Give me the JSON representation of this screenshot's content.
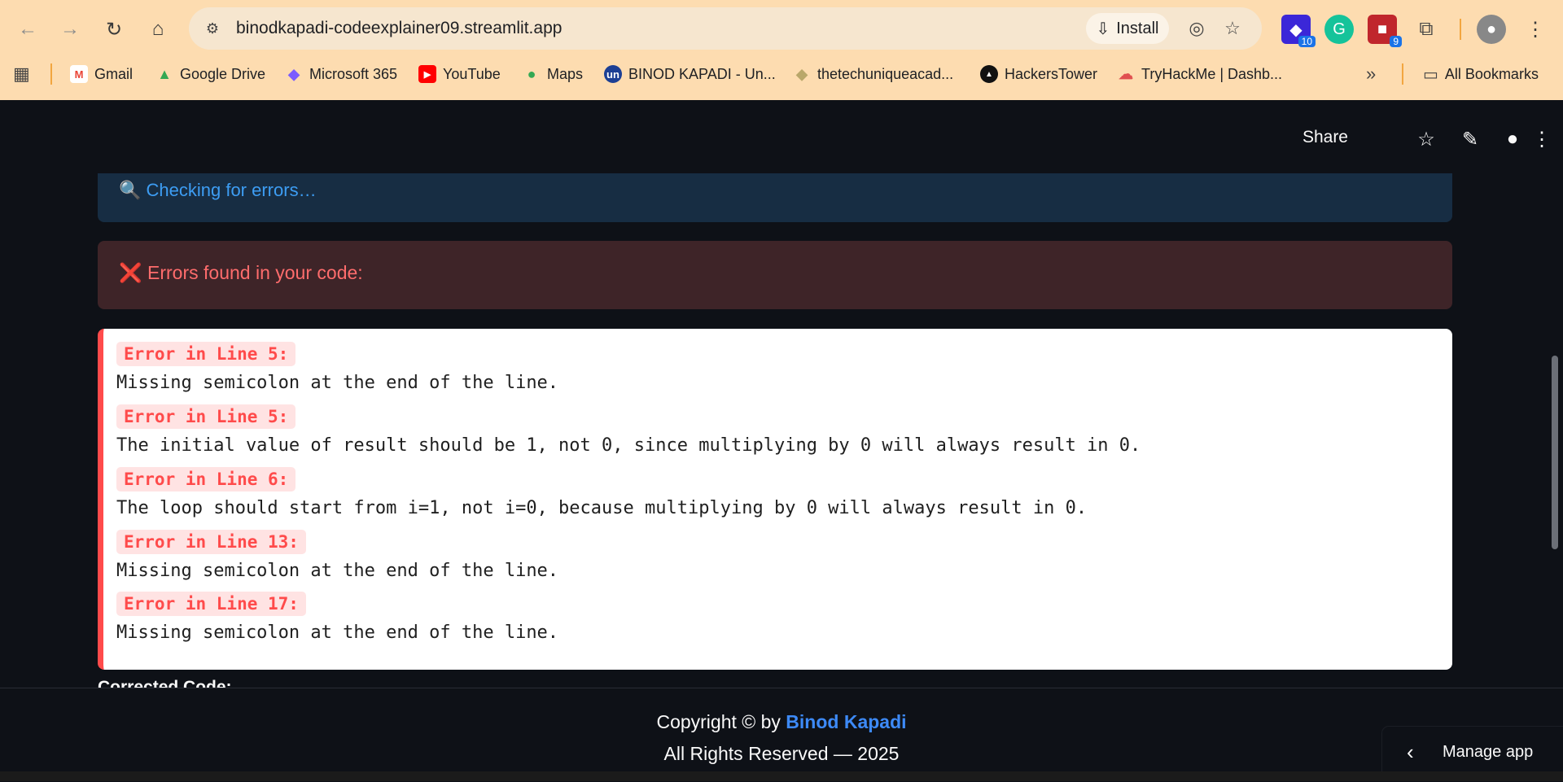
{
  "browser": {
    "url": "binodkapadi-codeexplainer09.streamlit.app",
    "install_label": "Install",
    "extensions": [
      {
        "name": "extension-1",
        "badge": "10",
        "color": "#3b27d8"
      },
      {
        "name": "grammarly",
        "badge": "",
        "color": "#15c39a"
      },
      {
        "name": "extension-3",
        "badge": "9",
        "color": "#c0262c"
      }
    ],
    "bookmarks": [
      {
        "label": "Gmail",
        "icon": "gmail-icon",
        "color": "#ea4335",
        "glyph": "M"
      },
      {
        "label": "Google Drive",
        "icon": "drive-icon",
        "color": "#34a853",
        "glyph": "▲"
      },
      {
        "label": "Microsoft 365",
        "icon": "microsoft365-icon",
        "color": "#7b5cff",
        "glyph": "◆"
      },
      {
        "label": "YouTube",
        "icon": "youtube-icon",
        "color": "#ff0000",
        "glyph": "▶"
      },
      {
        "label": "Maps",
        "icon": "maps-icon",
        "color": "#34a853",
        "glyph": "●"
      },
      {
        "label": "BINOD KAPADI - Un...",
        "icon": "un-icon",
        "color": "#1c3f94",
        "glyph": "un"
      },
      {
        "label": "thetechuniqueacad...",
        "icon": "shield-icon",
        "color": "#b9a76a",
        "glyph": "◆"
      },
      {
        "label": "HackersTower",
        "icon": "hackerstower-icon",
        "color": "#111111",
        "glyph": "▲"
      },
      {
        "label": "TryHackMe | Dashb...",
        "icon": "tryhackme-icon",
        "color": "#e05050",
        "glyph": "☁"
      }
    ],
    "all_bookmarks_label": "All Bookmarks"
  },
  "header": {
    "share_label": "Share"
  },
  "status": {
    "checking": "🔍 Checking for errors…",
    "errors_found": "❌ Errors found in your code:"
  },
  "errors": [
    {
      "tag": "Error in Line 5:",
      "desc": "Missing semicolon at the end of the line."
    },
    {
      "tag": "Error in Line 5:",
      "desc": "The initial value of result should be 1, not 0, since multiplying by 0 will always result in 0."
    },
    {
      "tag": "Error in Line 6:",
      "desc": "The loop should start from i=1, not i=0, because multiplying by 0 will always result in 0."
    },
    {
      "tag": "Error in Line 13:",
      "desc": "Missing semicolon at the end of the line."
    },
    {
      "tag": "Error in Line 17:",
      "desc": "Missing semicolon at the end of the line."
    }
  ],
  "corrected_label": "Corrected Code:",
  "footer": {
    "copyright_prefix": "Copyright © by ",
    "author": "Binod Kapadi",
    "rights": "All Rights Reserved — 2025"
  },
  "manage_app_label": "Manage app"
}
